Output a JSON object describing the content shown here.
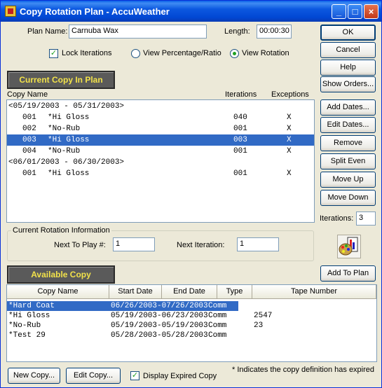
{
  "window": {
    "title": "Copy Rotation Plan - AccuWeather"
  },
  "header": {
    "plan_name_label": "Plan Name:",
    "plan_name_value": "Carnuba Wax",
    "length_label": "Length:",
    "length_value": "00:00:30",
    "lock_iterations_label": "Lock Iterations",
    "lock_iterations_checked": true,
    "view_percentage_label": "View Percentage/Ratio",
    "view_rotation_label": "View Rotation",
    "selected_view": "rotation"
  },
  "current_copy": {
    "banner": "Current Copy In Plan",
    "col_copy_name": "Copy Name",
    "col_iterations": "Iterations",
    "col_exceptions": "Exceptions",
    "rows": [
      {
        "type": "group",
        "text": "<05/19/2003 - 05/31/2003>"
      },
      {
        "type": "item",
        "num": "001",
        "name": "*Hi Gloss",
        "iter": "040",
        "exc": "X"
      },
      {
        "type": "item",
        "num": "002",
        "name": "*No-Rub",
        "iter": "001",
        "exc": "X"
      },
      {
        "type": "item",
        "num": "003",
        "name": "*Hi Gloss",
        "iter": "003",
        "exc": "X",
        "selected": true
      },
      {
        "type": "item",
        "num": "004",
        "name": "*No-Rub",
        "iter": "001",
        "exc": "X"
      },
      {
        "type": "group",
        "text": "<06/01/2003 - 06/30/2003>"
      },
      {
        "type": "item",
        "num": "001",
        "name": "*Hi Gloss",
        "iter": "001",
        "exc": "X"
      }
    ]
  },
  "rotation_info": {
    "group_title": "Current Rotation Information",
    "next_to_play_label": "Next To Play #:",
    "next_to_play_value": "1",
    "next_iteration_label": "Next Iteration:",
    "next_iteration_value": "1"
  },
  "side": {
    "ok": "OK",
    "cancel": "Cancel",
    "help": "Help",
    "show_orders": "Show Orders...",
    "add_dates": "Add Dates...",
    "edit_dates": "Edit Dates...",
    "remove": "Remove",
    "split_even": "Split Even",
    "move_up": "Move Up",
    "move_down": "Move Down",
    "iterations_label": "Iterations:",
    "iterations_value": "3",
    "add_to_plan": "Add To Plan"
  },
  "available_copy": {
    "banner": "Available Copy",
    "columns": [
      "Copy Name",
      "Start Date",
      "End Date",
      "Type",
      "Tape Number"
    ],
    "rows": [
      {
        "name": "*Hard Coat",
        "dates": "06/26/2003-07/26/2003",
        "type": "Comm",
        "tape": "",
        "selected": true
      },
      {
        "name": "*Hi Gloss",
        "dates": "05/19/2003-06/23/2003",
        "type": "Comm",
        "tape": "2547"
      },
      {
        "name": "*No-Rub",
        "dates": "05/19/2003-05/19/2003",
        "type": "Comm",
        "tape": "23"
      },
      {
        "name": "*Test 29",
        "dates": "05/28/2003-05/28/2003",
        "type": "Comm",
        "tape": ""
      }
    ]
  },
  "footer": {
    "new_copy": "New Copy...",
    "edit_copy": "Edit Copy...",
    "display_expired_label": "Display Expired Copy",
    "display_expired_checked": true,
    "note": "* Indicates the copy definition has expired"
  }
}
